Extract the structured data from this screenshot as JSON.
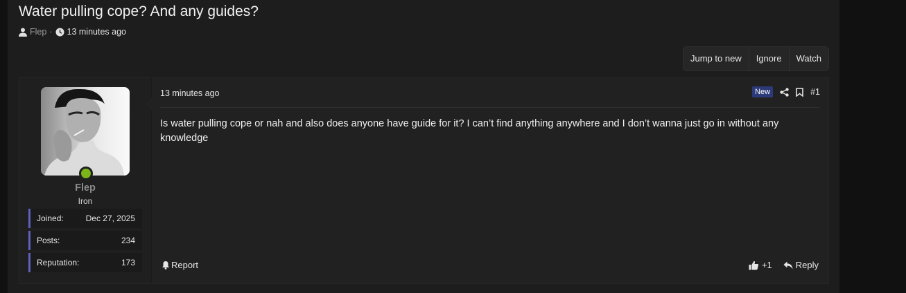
{
  "thread": {
    "title": "Water pulling cope? And any guides?",
    "author": "Flep",
    "separator": "·",
    "time_ago": "13 minutes ago"
  },
  "actions": {
    "jump_to_new": "Jump to new",
    "ignore": "Ignore",
    "watch": "Watch"
  },
  "post": {
    "time": "13 minutes ago",
    "new_badge": "New",
    "number": "#1",
    "message": "Is water pulling cope or nah and also does anyone have guide for it? I can’t find anything anywhere and I don’t wanna just go in without any knowledge",
    "report_label": "Report",
    "like_count": "+1",
    "reply_label": "Reply"
  },
  "user": {
    "name": "Flep",
    "rank": "Iron",
    "online_color": "#7cb518",
    "stats": [
      {
        "label": "Joined:",
        "value": "Dec 27, 2025"
      },
      {
        "label": "Posts:",
        "value": "234"
      },
      {
        "label": "Reputation:",
        "value": "173"
      }
    ]
  }
}
